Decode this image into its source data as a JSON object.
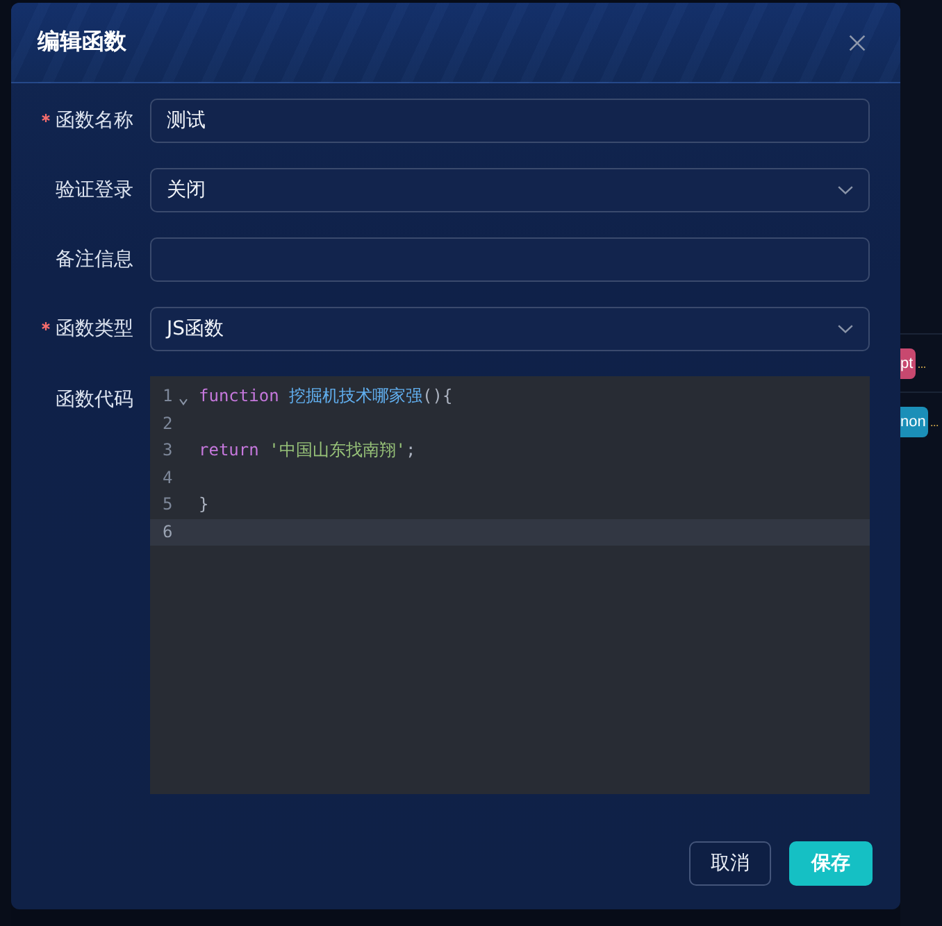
{
  "background_page": {
    "rows": [
      {
        "tag": "pt",
        "color": "#c8486f",
        "trailing": "..."
      },
      {
        "tag": "non",
        "color": "#1b8fb8",
        "trailing": "..."
      }
    ]
  },
  "dialog": {
    "title": "编辑函数",
    "fields": [
      {
        "kind": "input",
        "label": "函数名称",
        "required": true,
        "value": "测试"
      },
      {
        "kind": "select",
        "label": "验证登录",
        "required": false,
        "value": "关闭"
      },
      {
        "kind": "input",
        "label": "备注信息",
        "required": false
      },
      {
        "kind": "select",
        "label": "函数类型",
        "required": true,
        "value": "JS函数"
      },
      {
        "kind": "code",
        "label": "函数代码",
        "required": false,
        "lines": [
          {
            "number": "1",
            "foldable": true,
            "active": false,
            "tokens": [
              {
                "kind": "keyword",
                "text": "function "
              },
              {
                "kind": "function",
                "text": "挖掘机技术哪家强"
              },
              {
                "kind": "punctuation",
                "text": "(){"
              }
            ]
          },
          {
            "number": "2",
            "foldable": false,
            "active": false
          },
          {
            "number": "3",
            "foldable": false,
            "active": false,
            "tokens": [
              {
                "kind": "keyword",
                "text": "return "
              },
              {
                "kind": "string",
                "text": "'中国山东找南翔'"
              },
              {
                "kind": "punctuation",
                "text": ";"
              }
            ]
          },
          {
            "number": "4",
            "foldable": false,
            "active": false
          },
          {
            "number": "5",
            "foldable": false,
            "active": false,
            "tokens": [
              {
                "kind": "punctuation",
                "text": "}"
              }
            ]
          },
          {
            "number": "6",
            "foldable": false,
            "active": true
          }
        ]
      }
    ],
    "buttons": [
      {
        "kind": "secondary",
        "label": "取消"
      },
      {
        "kind": "primary",
        "label": "保存"
      }
    ]
  }
}
